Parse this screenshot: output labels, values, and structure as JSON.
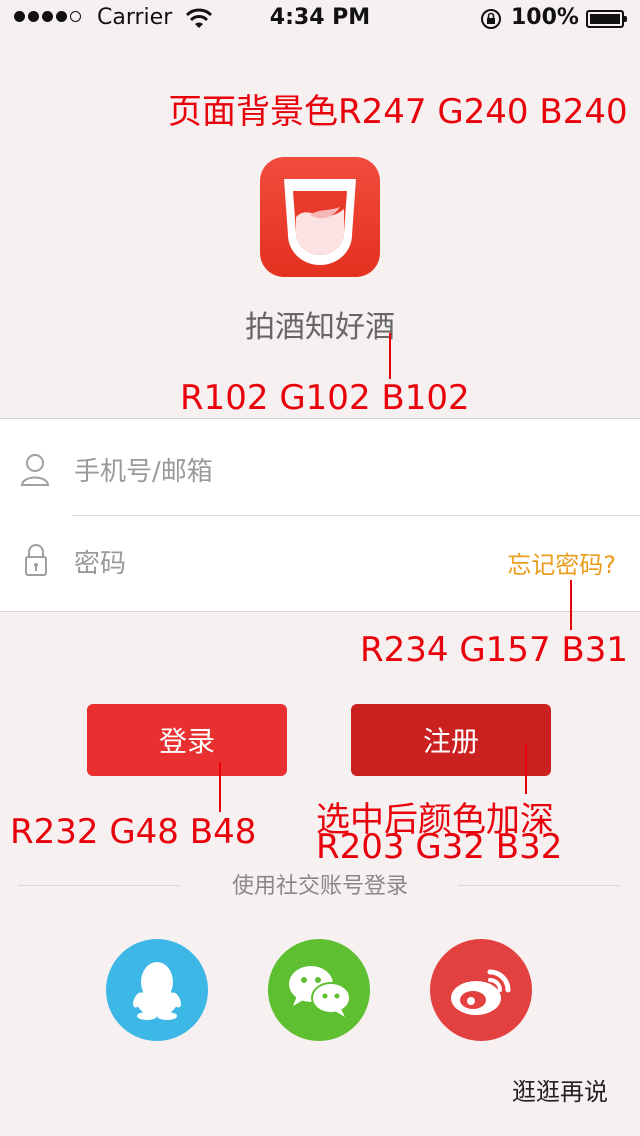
{
  "status_bar": {
    "carrier": "Carrier",
    "time": "4:34 PM",
    "battery": "100%",
    "signal_bars_filled": 4,
    "signal_bars_total": 5
  },
  "annotations": {
    "bg_color": "页面背景色R247 G240 B240",
    "name_color": "R102 G102 B102",
    "forgot_color": "R234 G157 B31",
    "login_color": "R232 G48 B48",
    "register_note": "选中后颜色加深",
    "register_color": "R203 G32 B32"
  },
  "app": {
    "name": "拍酒知好酒"
  },
  "login_form": {
    "username_placeholder": "手机号/邮箱",
    "password_placeholder": "密码",
    "forgot_password": "忘记密码?"
  },
  "buttons": {
    "login": "登录",
    "register": "注册"
  },
  "social": {
    "prompt": "使用社交账号登录",
    "providers": [
      "qq",
      "wechat",
      "weibo"
    ]
  },
  "skip": "逛逛再说",
  "colors": {
    "background": "#F7F0F0",
    "app_name": "#666666",
    "forgot_link": "#EA9D1F",
    "login_button": "#E83030",
    "register_button": "#CB2020",
    "annotation": "#E8000B"
  }
}
